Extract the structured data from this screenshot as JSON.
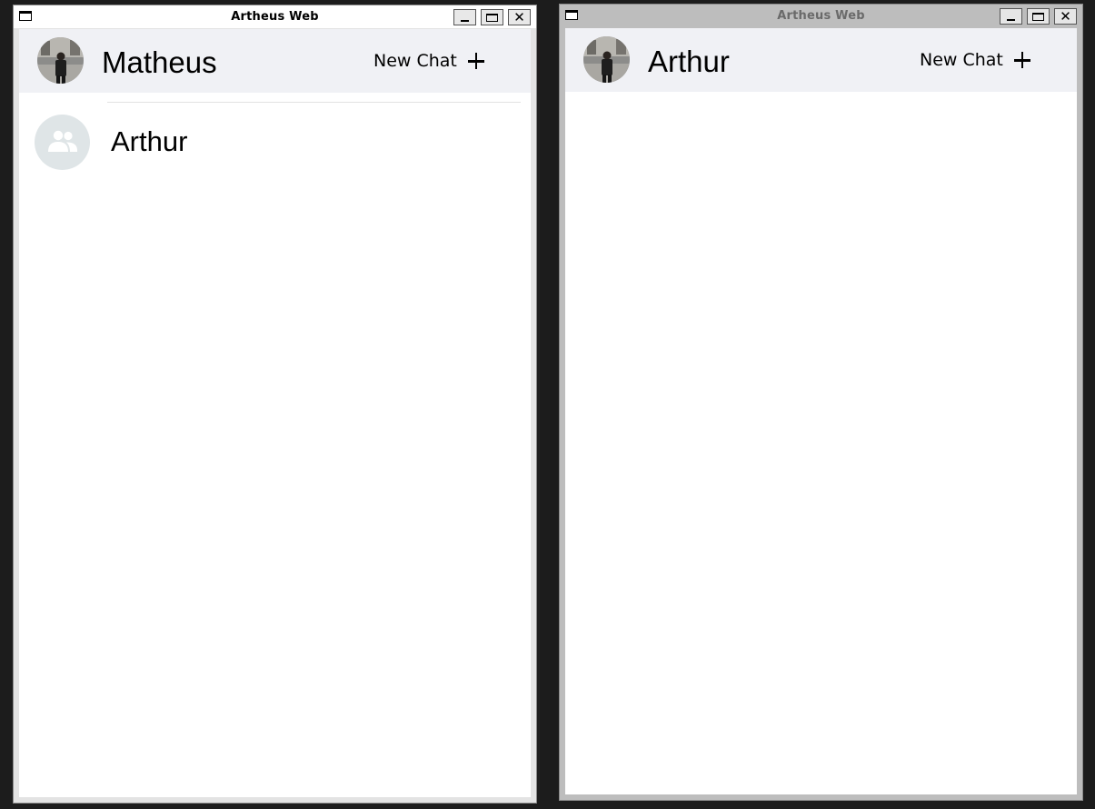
{
  "windows": [
    {
      "title": "Artheus Web",
      "active": true,
      "header": {
        "user_name": "Matheus",
        "new_chat_label": "New Chat",
        "avatar_icon": "user-photo-avatar",
        "plus_icon": "plus-icon"
      },
      "chats": [
        {
          "name": "Arthur",
          "avatar_icon": "group-icon"
        }
      ]
    },
    {
      "title": "Artheus Web",
      "active": false,
      "header": {
        "user_name": "Arthur",
        "new_chat_label": "New Chat",
        "avatar_icon": "user-photo-avatar",
        "plus_icon": "plus-icon"
      },
      "chats": []
    }
  ],
  "colors": {
    "header_bg": "#f0f1f5",
    "group_avatar_bg": "#dfe5e7",
    "active_title_bg": "#ffffff",
    "inactive_title_bg": "#bdbdbd",
    "desktop_bg": "#1c1c1c"
  }
}
